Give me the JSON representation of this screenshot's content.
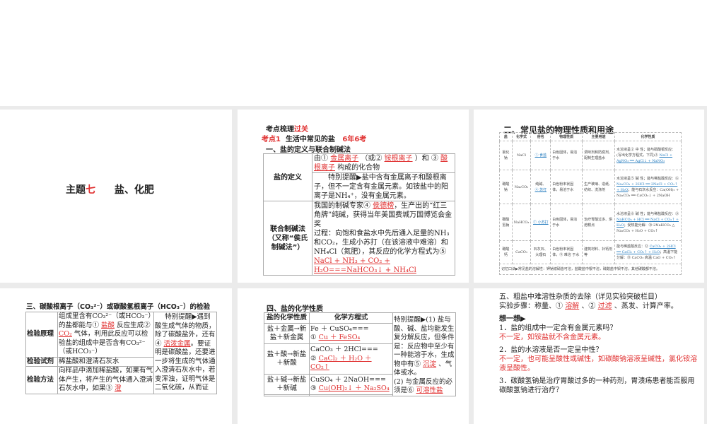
{
  "slide1": {
    "prefix": "主题",
    "num": "七",
    "title": "盐、化肥"
  },
  "slide2": {
    "h1a": "考点梳理",
    "h1b": "过关",
    "h2a": "考点1",
    "h2b": "生活中常见的盐",
    "h2c": "6年6考",
    "h3": "一、盐的定义与联合制碱法",
    "row1_label": "盐的定义",
    "def": {
      "t1": "由①",
      "a1": "金属离子",
      "t2": "（或②",
      "a2": "铵根离子",
      "t3": "）和",
      "t4": "③",
      "a3": "酸根离子",
      "t5": "构成的化合物"
    },
    "tip": "特别提醒▶盐中含有金属离子和酸根离子，但不一定含有金属元素。如铵盐中的阳离子是NH₄⁺，没有金属元素。",
    "row2_label": "联合制碱法（又称“侯氏制碱法”）",
    "lh": {
      "t1": "我国的制碱专家④",
      "a4": "侯德榜",
      "t2": "，生产出的“红三角牌”纯碱，获得当年美国费城万国博览会金奖",
      "t3": "过程：向饱和食盐水中先后通入足量的NH₃和CO₂，生成小苏打（在该溶液中难溶）和NH₄Cl（氮肥），其反应的化学方程式为⑤",
      "a5": "NaCl + NH₃ + CO₂ + H₂O===NaHCO₃↓ + NH₄Cl"
    }
  },
  "slide3": {
    "title": "二、常见盐的物理性质和用途",
    "headers": [
      "盐",
      "化学式",
      "俗名",
      "物理性质",
      "主要用途",
      "化学性质"
    ],
    "rows": [
      {
        "salt": "氯化钠",
        "formula": "NaCl",
        "alias_pre": "",
        "alias": "① 食盐",
        "phys": "白色固体，易溶于水",
        "use": "调味剂和防腐剂、配制生理盐水",
        "chem_t": "水溶液呈② 中 性；能与硝酸银反应：(写出化学方程式，下同)③",
        "chem_a": "NaCl + AgNO₃ ══ AgCl↓ + NaNO₃"
      },
      {
        "salt": "碳酸钠",
        "formula": "Na₂CO₃",
        "alias_pre": "纯碱、",
        "alias": "④ 苏打",
        "phys": "白色粉末状固体，易溶于水",
        "use": "生产玻璃、造纸、纺织、洗涤剂",
        "chem_t": "水溶液呈⑤ 碱 性；能与稀盐酸反应：⑥",
        "chem_a": "Na₂CO₃ + 2HCl ══ 2NaCl + CO₂↑ + H₂O",
        "chem_t2": "；能与石灰水反应：Ca(OH)₂ + Na₂CO₃ ══ CaCO₃↓ + 2NaOH"
      },
      {
        "salt": "碳酸氢钠",
        "formula": "NaHCO₃",
        "alias_pre": "",
        "alias": "⑦ 小苏打",
        "phys": "白色固体，易溶于水",
        "use": "治疗胃酸过多、烘焙糕点",
        "chem_t": "水溶液呈⑧ 碱 性；能与稀盐酸反应：⑨",
        "chem_a": "NaHCO₃ + HCl ══ NaCl + CO₂↑ + H₂O",
        "chem_t2": "；受热能分解：⑩ 2NaHCO₃ △ Na₂CO₃ + H₂O + CO₂↑"
      },
      {
        "salt": "碳酸钙",
        "formula": "CaCO₃",
        "alias_pre": "石灰石、大理石",
        "alias": "",
        "phys": "白色粉末状固体，⑪ 难溶 于水",
        "use": "建筑材料、补钙剂等",
        "chem_t": "能与稀盐酸反应：⑫",
        "chem_a": "CaCO₃ + 2HCl ══ CaCl₂ + CO₂↑ + H₂O",
        "chem_t2": "；高温下能分解：⑬ CaCO₃ 高温 CaO + CO₂↑"
      }
    ],
    "footer": "记忆口诀▶常见盐的溶解性：钾钠铵硝皆可溶，盐酸盐中银不溶，硫酸盐中钡不溶，其他碳酸都不溶。"
  },
  "slide4": {
    "title": "三、碳酸根离子（CO₃²⁻）或碳酸氢根离子（HCO₃⁻）的检验",
    "l1": "检验原理",
    "l2": "检验试剂",
    "l3": "检验方法",
    "p1a": "组成里含有CO₃²⁻（或HCO₃⁻）的盐都能与①",
    "a1": "盐酸",
    "p1b": "反应生成②",
    "a2": "CO₂",
    "p1c": "气体，利用此反应可以检验盐的组成中是否含有CO₃²⁻（或HCO₃⁻）",
    "p2": "稀盐酸和澄清石灰水",
    "p3": "向样品中滴加稀盐酸，如果有气体产生，将产生的气体通入澄清石灰水中，如果③",
    "a3": "澄",
    "tip_a": "特别提醒▶遇到酸生成气体的物质，除了碳酸盐外，还有④",
    "a4": "活泼金属",
    "tip_b": "。要证明是碳酸盐，还要进一步将生成的气体通入澄清石灰水中，若变浑浊，证明气体是二氧化碳，从而证"
  },
  "slide5": {
    "title": "四、盐的化学性质",
    "h1": "盐的化学性质",
    "h2": "化学方程式",
    "rows": [
      {
        "label": "盐＋金属→新盐＋新金属",
        "eq": "Fe ＋ CuSO₄===",
        "n": "①",
        "ans": "Cu ＋ FeSO₄"
      },
      {
        "label": "盐＋酸→新盐＋新酸",
        "eq": "CaCO₃ ＋ 2HCl===",
        "n": "②",
        "ans": "CaCl₂ ＋ H₂O ＋ CO₂↑"
      },
      {
        "label": "盐＋碱→新盐＋新碱",
        "eq": "CuSO₄ ＋ 2NaOH===",
        "n": "③",
        "ans": "Cu(OH)₂↓ ＋ Na₂SO₄"
      }
    ],
    "tip_a": "特别提醒▶(1) 盐与酸、碱、盐均能发生复分解反应，但条件是：反应物中至少有一种能溶于水，生成物中有⑤",
    "a5": "沉淀",
    "tip_b": "、气体或水。",
    "tip_c": "(2) 与金属反应的必须是⑥",
    "a6": "可溶性盐"
  },
  "slide6": {
    "l1": "五、粗盐中难溶性杂质的去除（详见实验突破栏目）",
    "l2a": "实验步骤：称量、①",
    "a1": "溶解",
    "l2b": "、②",
    "a2": "过滤",
    "l2c": "、蒸发、计算产率。",
    "think": "想一想▶",
    "q1": "1．盐的组成中一定含有金属元素吗？",
    "ans1": "不一定，如铵盐就不含金属元素。",
    "q2": "2．盐的水溶液是否一定呈中性？",
    "ans2": "不一定，也可能呈酸性或碱性，如碳酸钠溶液呈碱性，氯化铵溶液呈酸性。",
    "q3": "3．碳酸氢钠是治疗胃酸过多的一种药剂，胃溃疡患者能否服用碳酸氢钠进行治疗？"
  }
}
